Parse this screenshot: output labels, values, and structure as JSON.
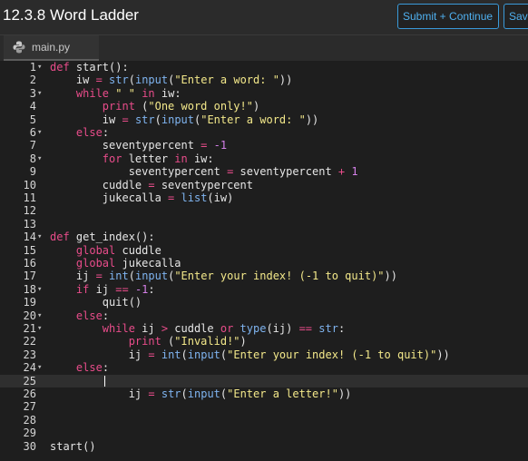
{
  "header": {
    "title": "12.3.8 Word Ladder",
    "submit_label": "Submit + Continue",
    "save_label": "Save"
  },
  "tabs": [
    {
      "label": "main.py",
      "icon": "python-icon",
      "active": true
    }
  ],
  "editor": {
    "active_line": 25,
    "lines": [
      {
        "n": "1",
        "fold": true,
        "html": "<span class=\"kw\">def</span> start():"
      },
      {
        "n": "2",
        "fold": false,
        "html": "    iw <span class=\"op\">=</span> <span class=\"fn\">str</span>(<span class=\"fn\">input</span>(<span class=\"st\">\"Enter a word: \"</span>))"
      },
      {
        "n": "3",
        "fold": true,
        "html": "    <span class=\"kw\">while</span> <span class=\"st\">\" \"</span> <span class=\"kw\">in</span> iw:"
      },
      {
        "n": "4",
        "fold": false,
        "html": "        <span class=\"kw\">print</span> (<span class=\"st\">\"One word only!\"</span>)"
      },
      {
        "n": "5",
        "fold": false,
        "html": "        iw <span class=\"op\">=</span> <span class=\"fn\">str</span>(<span class=\"fn\">input</span>(<span class=\"st\">\"Enter a word: \"</span>))"
      },
      {
        "n": "6",
        "fold": true,
        "html": "    <span class=\"kw\">else</span>:"
      },
      {
        "n": "7",
        "fold": false,
        "html": "        seventypercent <span class=\"op\">=</span> <span class=\"nu\">-1</span>"
      },
      {
        "n": "8",
        "fold": true,
        "html": "        <span class=\"kw\">for</span> letter <span class=\"kw\">in</span> iw:"
      },
      {
        "n": "9",
        "fold": false,
        "html": "            seventypercent <span class=\"op\">=</span> seventypercent <span class=\"op\">+</span> <span class=\"nu\">1</span>"
      },
      {
        "n": "10",
        "fold": false,
        "html": "        cuddle <span class=\"op\">=</span> seventypercent"
      },
      {
        "n": "11",
        "fold": false,
        "html": "        jukecalla <span class=\"op\">=</span> <span class=\"fn\">list</span>(iw)"
      },
      {
        "n": "12",
        "fold": false,
        "html": ""
      },
      {
        "n": "13",
        "fold": false,
        "html": ""
      },
      {
        "n": "14",
        "fold": true,
        "html": "<span class=\"kw\">def</span> get_index():"
      },
      {
        "n": "15",
        "fold": false,
        "html": "    <span class=\"kw\">global</span> cuddle"
      },
      {
        "n": "16",
        "fold": false,
        "html": "    <span class=\"kw\">global</span> jukecalla"
      },
      {
        "n": "17",
        "fold": false,
        "html": "    ij <span class=\"op\">=</span> <span class=\"fn\">int</span>(<span class=\"fn\">input</span>(<span class=\"st\">\"Enter your index! (-1 to quit)\"</span>))"
      },
      {
        "n": "18",
        "fold": true,
        "html": "    <span class=\"kw\">if</span> ij <span class=\"op\">==</span> <span class=\"nu\">-1</span>:"
      },
      {
        "n": "19",
        "fold": false,
        "html": "        quit()"
      },
      {
        "n": "20",
        "fold": true,
        "html": "    <span class=\"kw\">else</span>:"
      },
      {
        "n": "21",
        "fold": true,
        "html": "        <span class=\"kw\">while</span> ij <span class=\"op\">&gt;</span> cuddle <span class=\"kw\">or</span> <span class=\"fn\">type</span>(ij) <span class=\"op\">==</span> <span class=\"fn\">str</span>:"
      },
      {
        "n": "22",
        "fold": false,
        "html": "            <span class=\"kw\">print</span> (<span class=\"st\">\"Invalid!\"</span>)"
      },
      {
        "n": "23",
        "fold": false,
        "html": "            ij <span class=\"op\">=</span> <span class=\"fn\">int</span>(<span class=\"fn\">input</span>(<span class=\"st\">\"Enter your index! (-1 to quit)\"</span>))"
      },
      {
        "n": "24",
        "fold": true,
        "html": "    <span class=\"kw\">else</span>:"
      },
      {
        "n": "25",
        "fold": false,
        "html": ""
      },
      {
        "n": "26",
        "fold": false,
        "html": "            ij <span class=\"op\">=</span> <span class=\"fn\">str</span>(<span class=\"fn\">input</span>(<span class=\"st\">\"Enter a letter!\"</span>))"
      },
      {
        "n": "27",
        "fold": false,
        "html": ""
      },
      {
        "n": "28",
        "fold": false,
        "html": ""
      },
      {
        "n": "29",
        "fold": false,
        "html": ""
      },
      {
        "n": "30",
        "fold": false,
        "html": "start()"
      }
    ]
  }
}
